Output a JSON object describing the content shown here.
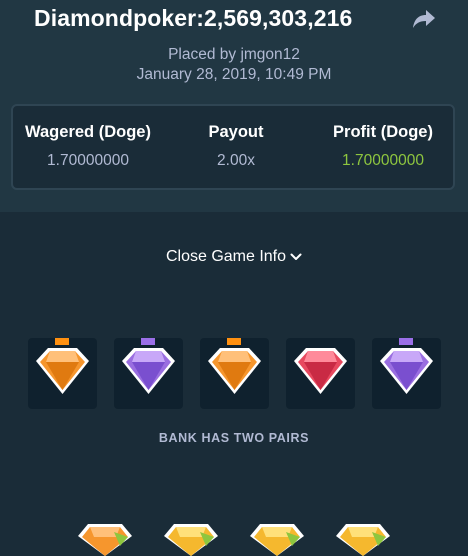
{
  "header": {
    "title": "Diamondpoker:2,569,303,216",
    "share_icon": "share-arrow-icon",
    "placed_by": "Placed by jmgon12",
    "date": "January 28, 2019, 10:49 PM"
  },
  "stats": {
    "wagered_label": "Wagered (Doge)",
    "wagered_value": "1.70000000",
    "payout_label": "Payout",
    "payout_value": "2.00x",
    "profit_label": "Profit (Doge)",
    "profit_value": "1.70000000"
  },
  "close_info": {
    "label": "Close Game Info",
    "icon": "chevron-down-icon"
  },
  "bank": {
    "gems": [
      "orange",
      "purple",
      "orange",
      "red",
      "purple"
    ],
    "result": "BANK HAS TWO PAIRS"
  },
  "player": {
    "gems": [
      "orange",
      "yellow",
      "yellow",
      "yellow"
    ]
  },
  "colors": {
    "background": "#1a2c38",
    "header_bg": "#213743",
    "muted_text": "#b1bad3",
    "profit_green": "#8ec63f",
    "tile_bg": "#0f212e"
  }
}
